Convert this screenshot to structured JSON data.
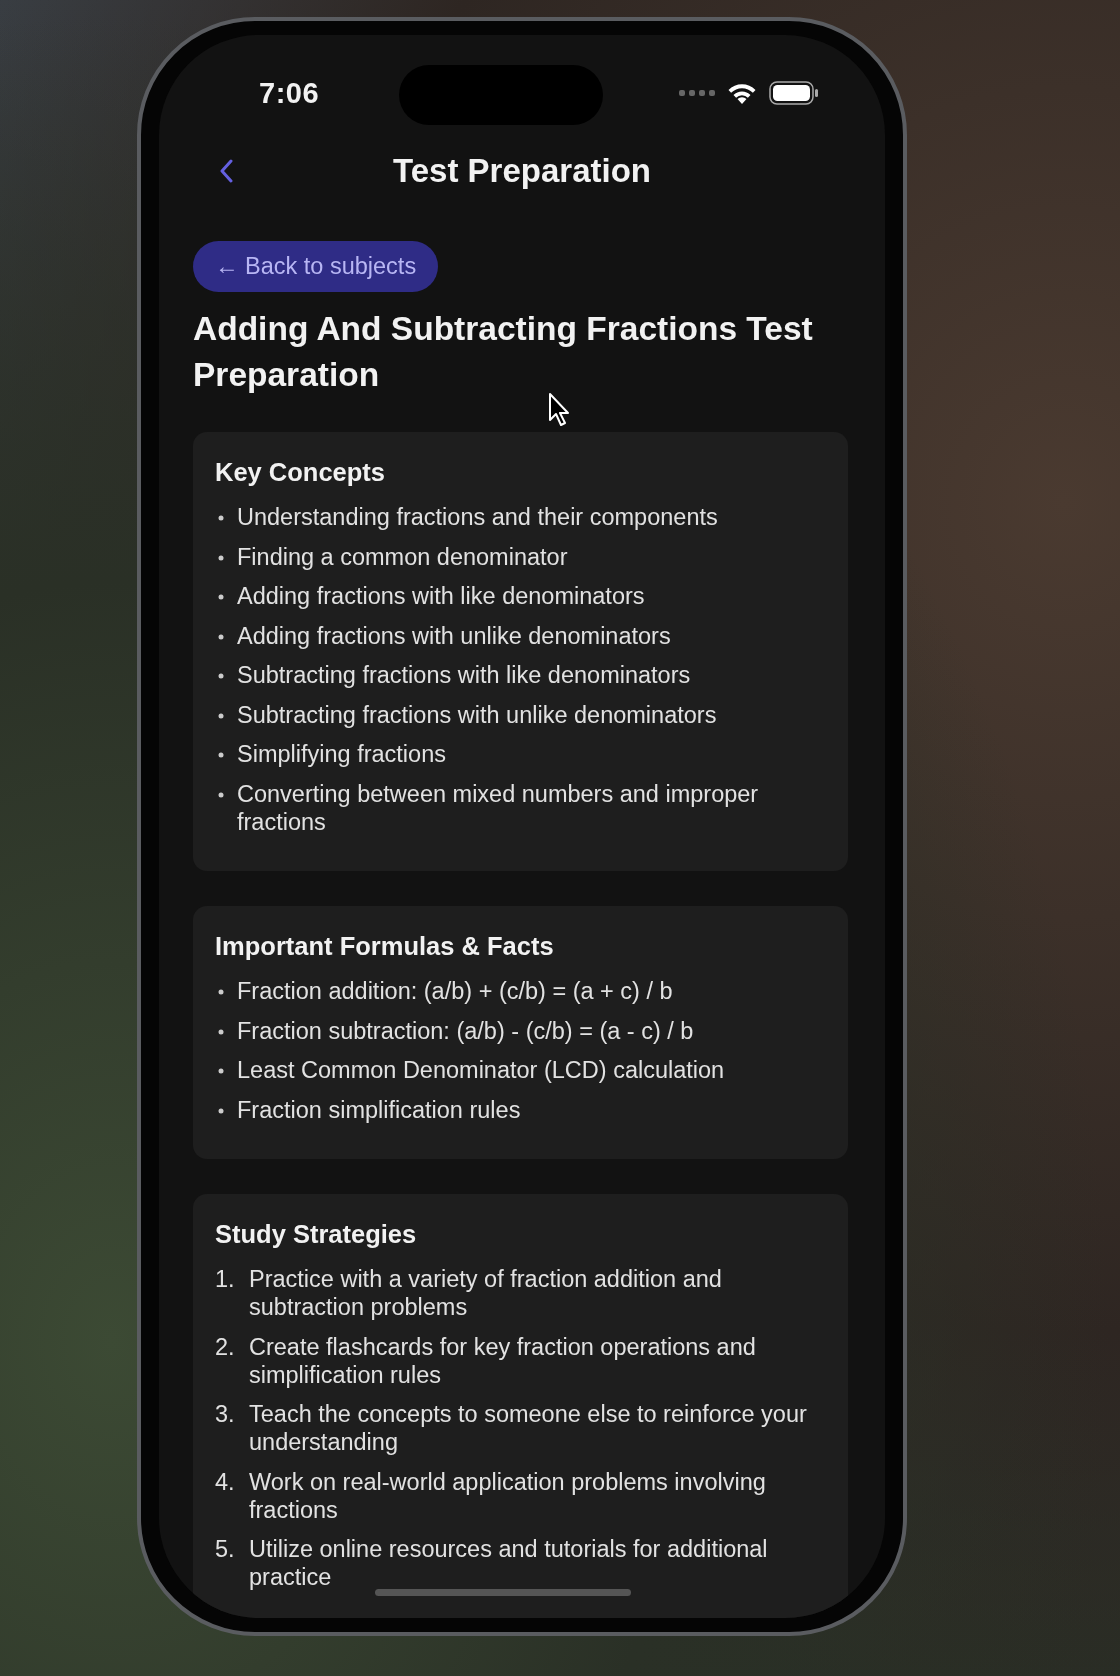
{
  "status_bar": {
    "time": "7:06"
  },
  "nav": {
    "title": "Test Preparation"
  },
  "back_button": {
    "label": "← Back to subjects"
  },
  "page_title": "Adding And Subtracting Fractions Test Preparation",
  "sections": [
    {
      "heading": "Key Concepts",
      "kind": "bullets",
      "items": [
        "Understanding fractions and their components",
        "Finding a common denominator",
        "Adding fractions with like denominators",
        "Adding fractions with unlike denominators",
        "Subtracting fractions with like denominators",
        "Subtracting fractions with unlike denominators",
        "Simplifying fractions",
        "Converting between mixed numbers and improper fractions"
      ]
    },
    {
      "heading": "Important Formulas & Facts",
      "kind": "bullets",
      "items": [
        "Fraction addition: (a/b) + (c/b) = (a + c) / b",
        "Fraction subtraction: (a/b) - (c/b) = (a - c) / b",
        "Least Common Denominator (LCD) calculation",
        "Fraction simplification rules"
      ]
    },
    {
      "heading": "Study Strategies",
      "kind": "numbered",
      "items": [
        {
          "number": "1.",
          "text": "Practice with a variety of fraction addition and subtraction problems"
        },
        {
          "number": "2.",
          "text": "Create flashcards for key fraction operations and simplification rules"
        },
        {
          "number": "3.",
          "text": "Teach the concepts to someone else to reinforce your understanding"
        },
        {
          "number": "4.",
          "text": "Work on real-world application problems involving fractions"
        },
        {
          "number": "5.",
          "text": "Utilize online resources and tutorials for additional practice"
        }
      ]
    }
  ]
}
